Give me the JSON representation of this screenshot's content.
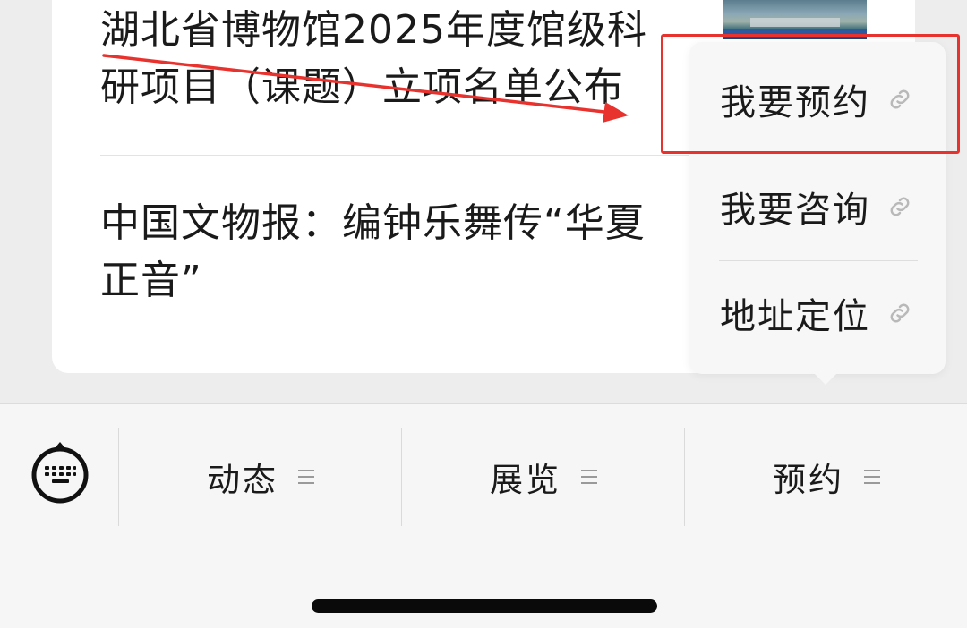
{
  "articles": [
    {
      "title": "湖北省博物馆2025年度馆级科研项目（课题）立项名单公布"
    },
    {
      "title": "中国文物报：编钟乐舞传“华夏正音”"
    }
  ],
  "popup_menu": {
    "items": [
      {
        "label": "我要预约",
        "icon": "link-icon"
      },
      {
        "label": "我要咨询",
        "icon": "link-icon"
      },
      {
        "label": "地址定位",
        "icon": "link-icon"
      }
    ]
  },
  "bottom_bar": {
    "keyboard_icon": "keyboard-icon",
    "tabs": [
      {
        "label": "动态",
        "icon": "menu-lines-icon"
      },
      {
        "label": "展览",
        "icon": "menu-lines-icon"
      },
      {
        "label": "预约",
        "icon": "menu-lines-icon"
      }
    ]
  },
  "colors": {
    "annotation_red": "#e8322e",
    "card_background": "#ffffff",
    "page_background": "#ededed",
    "bottom_bar_background": "#f6f6f6"
  }
}
